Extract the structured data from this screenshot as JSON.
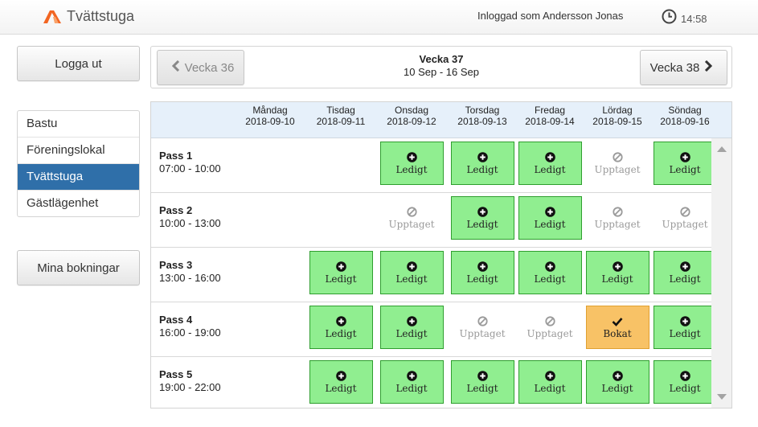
{
  "header": {
    "brand": "Tvättstuga",
    "user_label": "Inloggad som Andersson Jonas",
    "time": "14:58",
    "brand_color": "#f26522"
  },
  "sidebar": {
    "logout_label": "Logga ut",
    "my_bookings_label": "Mina bokningar",
    "items": [
      {
        "label": "Bastu",
        "active": false
      },
      {
        "label": "Föreningslokal",
        "active": false
      },
      {
        "label": "Tvättstuga",
        "active": true
      },
      {
        "label": "Gästlägenhet",
        "active": false
      }
    ],
    "active_color": "#2f6fa9"
  },
  "weeknav": {
    "prev_label": "Vecka 36",
    "next_label": "Vecka 38",
    "title": "Vecka 37",
    "range": "10 Sep - 16 Sep"
  },
  "days": [
    {
      "name": "Måndag",
      "date": "2018-09-10"
    },
    {
      "name": "Tisdag",
      "date": "2018-09-11"
    },
    {
      "name": "Onsdag",
      "date": "2018-09-12"
    },
    {
      "name": "Torsdag",
      "date": "2018-09-13"
    },
    {
      "name": "Fredag",
      "date": "2018-09-14"
    },
    {
      "name": "Lördag",
      "date": "2018-09-15"
    },
    {
      "name": "Söndag",
      "date": "2018-09-16"
    }
  ],
  "status_labels": {
    "free": "Ledigt",
    "taken": "Upptaget",
    "booked": "Bokat"
  },
  "status_icons": {
    "free": "plus-circle-icon",
    "taken": "ban-icon",
    "booked": "check-icon"
  },
  "status_colors": {
    "free": "#90ee90",
    "booked": "#f8c266",
    "taken": "#9a9a9a"
  },
  "passes": [
    {
      "name": "Pass 1",
      "time": "07:00 - 10:00",
      "slots": [
        null,
        null,
        "free",
        "free",
        "free",
        "taken",
        "free"
      ]
    },
    {
      "name": "Pass 2",
      "time": "10:00 - 13:00",
      "slots": [
        null,
        null,
        "taken",
        "free",
        "free",
        "taken",
        "taken"
      ]
    },
    {
      "name": "Pass 3",
      "time": "13:00 - 16:00",
      "slots": [
        null,
        "free",
        "free",
        "free",
        "free",
        "free",
        "free"
      ]
    },
    {
      "name": "Pass 4",
      "time": "16:00 - 19:00",
      "slots": [
        null,
        "free",
        "free",
        "taken",
        "taken",
        "booked",
        "free"
      ]
    },
    {
      "name": "Pass 5",
      "time": "19:00 - 22:00",
      "slots": [
        null,
        "free",
        "free",
        "free",
        "free",
        "free",
        "free"
      ]
    }
  ]
}
